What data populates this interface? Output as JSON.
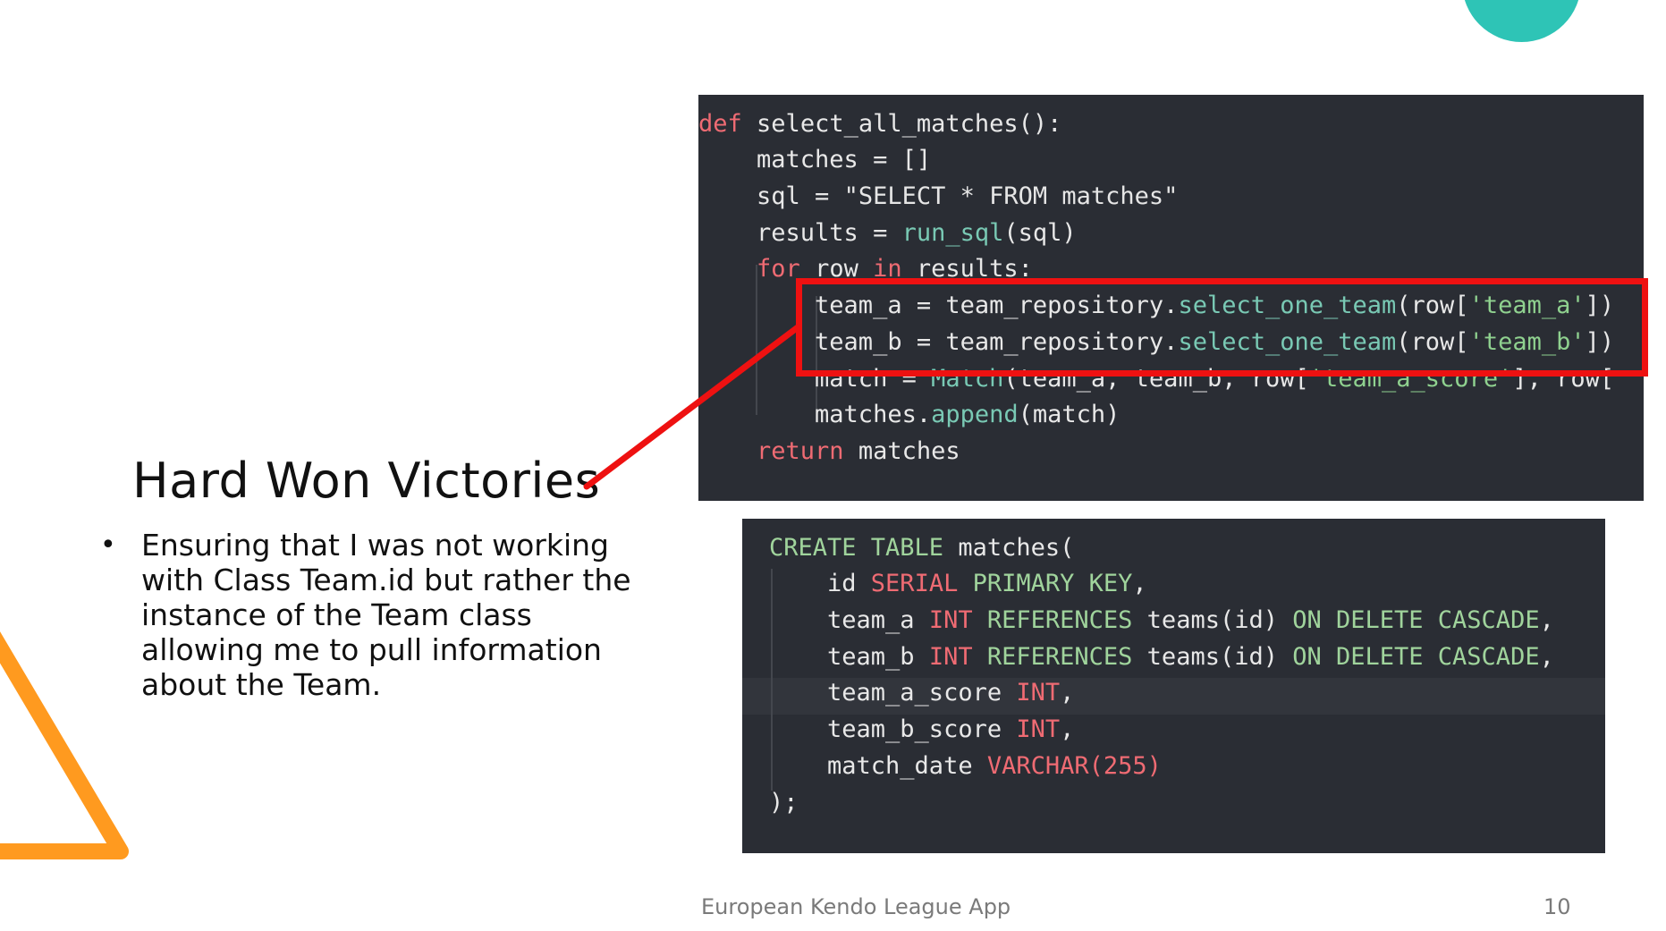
{
  "slide": {
    "title": "Hard Won Victories",
    "bullet": "Ensuring that I was not working with Class Team.id but rather the instance of the Team class allowing me to pull information about the Team.",
    "footer_text": "European Kendo League App",
    "page_number": "10"
  },
  "colors": {
    "accent_teal": "#2ec4b6",
    "accent_orange": "#ff9a1f",
    "highlight_red": "#ee1111",
    "code_background": "#2a2d34"
  },
  "code_python": {
    "lines": [
      "def select_all_matches():",
      "    matches = []",
      "    sql = \"SELECT * FROM matches\"",
      "    results = run_sql(sql)",
      "    for row in results:",
      "        team_a = team_repository.select_one_team(row['team_a'])",
      "        team_b = team_repository.select_one_team(row['team_b'])",
      "        match = Match(team_a, team_b, row['team_a_score'], row[",
      "        matches.append(match)",
      "    return matches"
    ]
  },
  "code_sql": {
    "lines": [
      "CREATE TABLE matches(",
      "    id SERIAL PRIMARY KEY,",
      "    team_a INT REFERENCES teams(id) ON DELETE CASCADE,",
      "    team_b INT REFERENCES teams(id) ON DELETE CASCADE,",
      "    team_a_score INT,",
      "    team_b_score INT,",
      "    match_date VARCHAR(255)",
      ");"
    ]
  }
}
